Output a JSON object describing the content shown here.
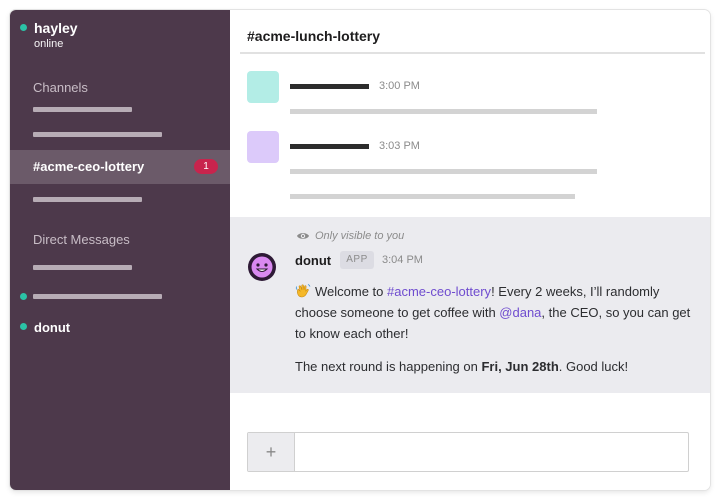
{
  "user": {
    "name": "hayley",
    "status": "online"
  },
  "sidebar": {
    "channels_header": "Channels",
    "active_channel": {
      "label": "#acme-ceo-lottery",
      "unread_count": "1"
    },
    "dm_header": "Direct Messages",
    "dm_named": "donut"
  },
  "main": {
    "channel_title": "#acme-lunch-lottery",
    "messages": [
      {
        "time": "3:00 PM"
      },
      {
        "time": "3:03 PM"
      }
    ],
    "ephemeral": {
      "visibility_note": "Only visible to you",
      "author": "donut",
      "app_tag": "APP",
      "time": "3:04 PM",
      "p1_a": "Welcome to ",
      "p1_link": "#acme-ceo-lottery",
      "p1_b": "! Every 2 weeks, I’ll randomly choose someone to get coffee with ",
      "p1_mention": "@dana",
      "p1_c": ", the CEO, so you can get to know each other!",
      "p2_a": "The next round is happening on ",
      "p2_bold": "Fri, Jun 28th",
      "p2_b": ". Good luck!"
    },
    "composer": {
      "plus_label": "+"
    }
  },
  "colors": {
    "sidebar_bg": "#4d394b",
    "sidebar_active": "#6b5a69",
    "presence": "#2bc2a6",
    "badge": "#c8244d",
    "link": "#6f4ccf",
    "avatar_1": "#b3ede6",
    "avatar_2": "#dccafa",
    "ephemeral_bg": "#ebebef"
  },
  "icons": [
    "eye-icon",
    "donut-avatar-icon",
    "waving-hand-icon",
    "plus-icon"
  ]
}
